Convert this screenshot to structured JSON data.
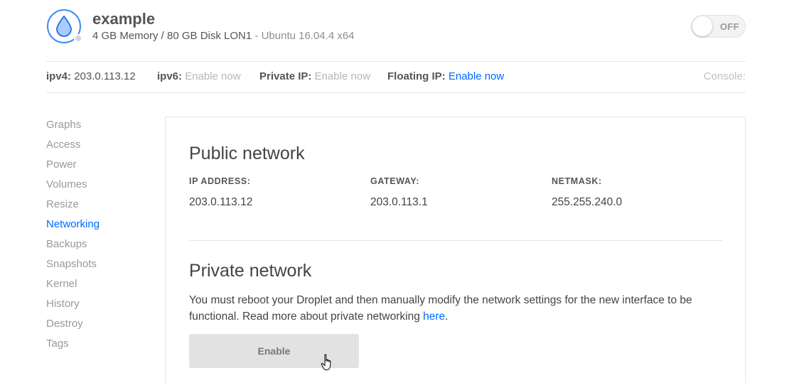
{
  "droplet": {
    "name": "example",
    "specs": "4 GB Memory / 80 GB Disk LON1",
    "separator": " - ",
    "os": "Ubuntu 16.04.4 x64",
    "power_toggle_label": "OFF"
  },
  "ipbar": {
    "ipv4_label": "ipv4:",
    "ipv4_value": "203.0.113.12",
    "ipv6_label": "ipv6:",
    "ipv6_action": "Enable now",
    "private_ip_label": "Private IP:",
    "private_ip_action": "Enable now",
    "floating_ip_label": "Floating IP:",
    "floating_ip_action": "Enable now",
    "console_label": "Console:"
  },
  "sidebar": {
    "active": "Networking",
    "items": [
      {
        "label": "Graphs"
      },
      {
        "label": "Access"
      },
      {
        "label": "Power"
      },
      {
        "label": "Volumes"
      },
      {
        "label": "Resize"
      },
      {
        "label": "Networking"
      },
      {
        "label": "Backups"
      },
      {
        "label": "Snapshots"
      },
      {
        "label": "Kernel"
      },
      {
        "label": "History"
      },
      {
        "label": "Destroy"
      },
      {
        "label": "Tags"
      }
    ]
  },
  "public_network": {
    "title": "Public network",
    "ip_label": "IP ADDRESS:",
    "ip_value": "203.0.113.12",
    "gateway_label": "GATEWAY:",
    "gateway_value": "203.0.113.1",
    "netmask_label": "NETMASK:",
    "netmask_value": "255.255.240.0"
  },
  "private_network": {
    "title": "Private network",
    "description": "You must reboot your Droplet and then manually modify the network settings for the new interface to be functional. Read more about private networking ",
    "link_text": "here",
    "description_end": ".",
    "button_label": "Enable"
  },
  "colors": {
    "accent": "#0069ff",
    "muted_text": "#999999",
    "button_bg": "#e2e2e2"
  }
}
